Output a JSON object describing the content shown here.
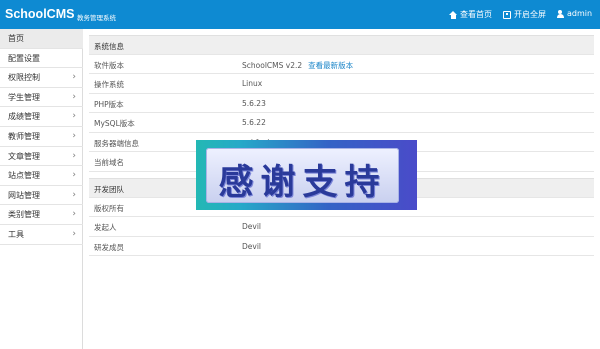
{
  "header": {
    "brand": "SchoolCMS",
    "brand_sub": "教务管理系统",
    "home_label": "查看首页",
    "fullscreen_label": "开启全屏",
    "user_label": "admin"
  },
  "sidebar": {
    "items": [
      {
        "label": "首页"
      },
      {
        "label": "配置设置"
      },
      {
        "label": "权限控制"
      },
      {
        "label": "学生管理"
      },
      {
        "label": "成绩管理"
      },
      {
        "label": "教师管理"
      },
      {
        "label": "文章管理"
      },
      {
        "label": "站点管理"
      },
      {
        "label": "网站管理"
      },
      {
        "label": "类别管理"
      },
      {
        "label": "工具"
      }
    ]
  },
  "system_info": {
    "title": "系统信息",
    "rows": [
      {
        "key": "软件版本",
        "value": "SchoolCMS v2.2",
        "link": "查看最新版本"
      },
      {
        "key": "操作系统",
        "value": "Linux"
      },
      {
        "key": "PHP版本",
        "value": "5.6.23"
      },
      {
        "key": "MySQL版本",
        "value": "5.6.22"
      },
      {
        "key": "服务器端信息",
        "value": "cgi-fcgi"
      },
      {
        "key": "当前域名",
        "value": ""
      }
    ]
  },
  "dev_team": {
    "title": "开发团队",
    "rows": [
      {
        "key": "版权所有",
        "value": ""
      },
      {
        "key": "发起人",
        "value": "Devil"
      },
      {
        "key": "研发成员",
        "value": "Devil"
      }
    ]
  },
  "banner": {
    "text": "感谢支持"
  },
  "colors": {
    "header_bg": "#0e8ad2",
    "link": "#1a85c8",
    "section_bg": "#efefef"
  }
}
